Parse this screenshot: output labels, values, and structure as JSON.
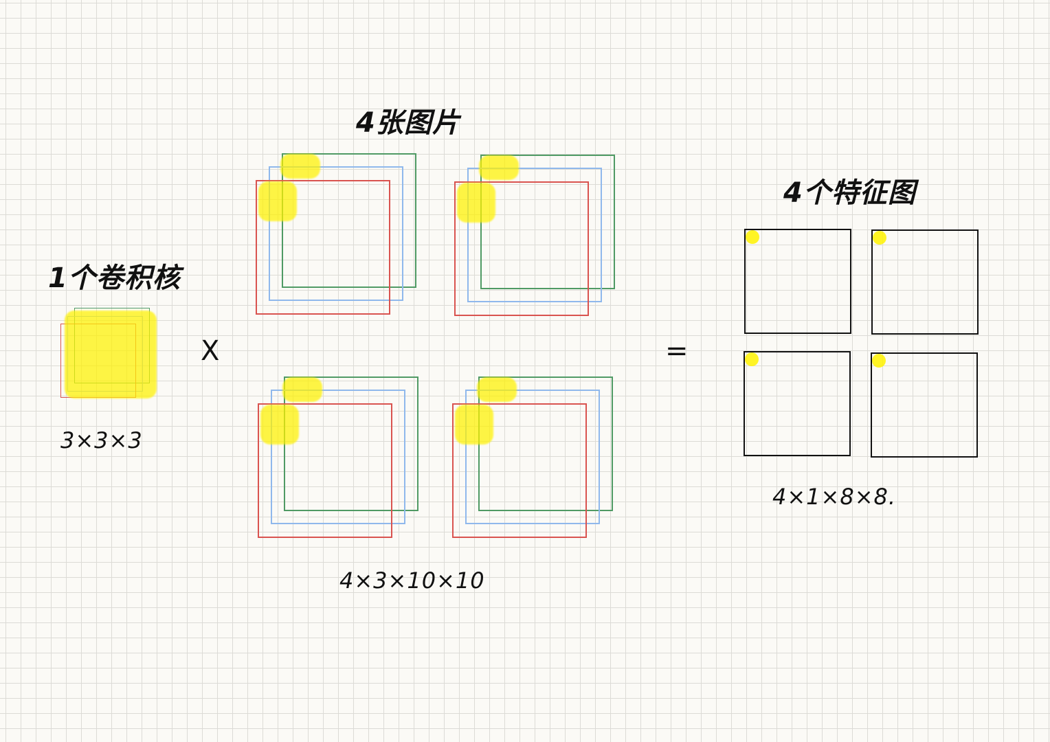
{
  "kernel": {
    "title": "1个卷积核",
    "dims": "3×3×3"
  },
  "images": {
    "title": "4张图片",
    "dims": "4×3×10×10",
    "count": 4,
    "channels": 3
  },
  "features": {
    "title": "4个特征图",
    "dims": "4×1×8×8.",
    "count": 4
  },
  "operators": {
    "multiply": "X",
    "equals": "="
  },
  "colors": {
    "channel_red": "#d9534f",
    "channel_blue": "#8fb8ec",
    "channel_green": "#4f9a64",
    "highlight": "#fff200",
    "feature_border": "#111111"
  }
}
